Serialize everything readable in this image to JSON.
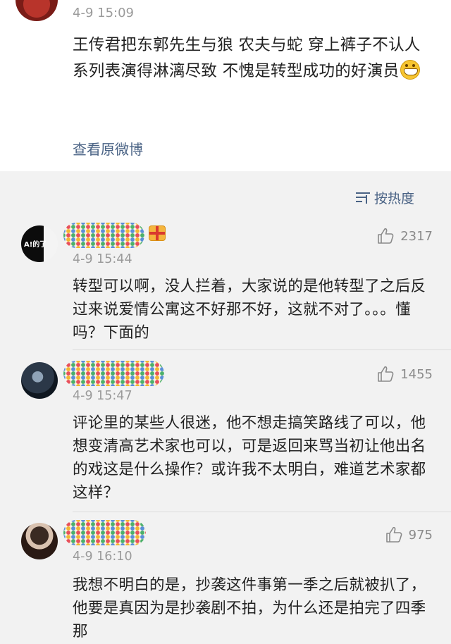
{
  "post": {
    "time": "4-9 15:09",
    "text": "王传君把东郭先生与狼 农夫与蛇 穿上裤子不认人系列表演得淋漓尽致 不愧是转型成功的好演员",
    "emoji": "grin-emoji",
    "view_original": "查看原微博"
  },
  "sort": {
    "label": "按热度",
    "icon": "sort-icon"
  },
  "comments": [
    {
      "avatar_text": "A!的了",
      "time": "4-9 15:44",
      "text": "转型可以啊，没人拦着，大家说的是他转型了之后反过来说爱情公寓这不好那不好，这就不对了。。。懂吗？下面的",
      "likes": "2317"
    },
    {
      "time": "4-9 15:47",
      "text": "评论里的某些人很迷，他不想走搞笑路线了可以，他想变清高艺术家也可以，可是返回来骂当初让他出名的戏这是什么操作？或许我不太明白，难道艺术家都这样？",
      "likes": "1455"
    },
    {
      "time": "4-9 16:10",
      "text": "我想不明白的是，抄袭这件事第一季之后就被扒了，他要是真因为是抄袭剧不拍，为什么还是拍完了四季那",
      "likes": "975"
    }
  ],
  "colors": {
    "link": "#4a6385",
    "muted": "#9a9a9a",
    "text": "#222222",
    "bg": "#f2f2f2"
  }
}
